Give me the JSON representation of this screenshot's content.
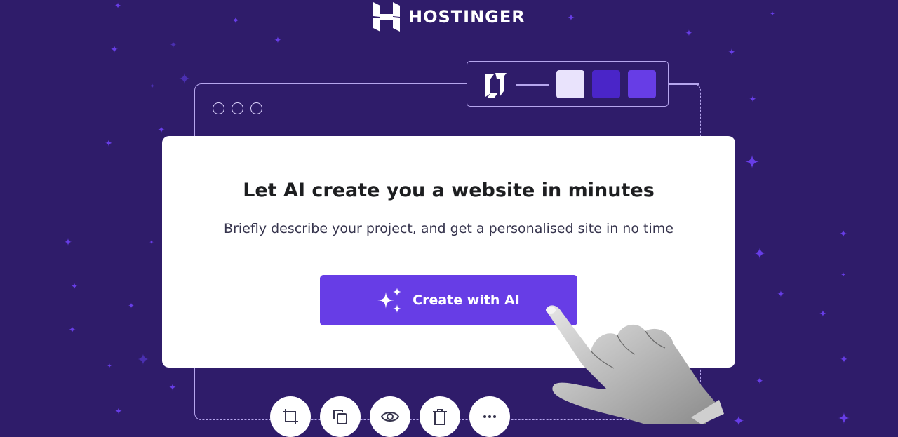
{
  "brand": {
    "name": "HOSTINGER"
  },
  "hero": {
    "title": "Let AI create you a website in minutes",
    "subtitle": "Briefly describe your project, and get a personalised site in no time",
    "cta_label": "Create with AI",
    "cta_icon": "sparkles-icon"
  },
  "palette": {
    "icon": "hostinger-cube-icon",
    "swatches": [
      "#e9e3fc",
      "#4a25c8",
      "#673de6"
    ]
  },
  "toolbar": {
    "items": [
      {
        "name": "crop",
        "icon": "crop-icon"
      },
      {
        "name": "duplicate",
        "icon": "copy-icon"
      },
      {
        "name": "preview",
        "icon": "eye-icon"
      },
      {
        "name": "delete",
        "icon": "trash-icon"
      },
      {
        "name": "more",
        "icon": "more-icon"
      }
    ]
  },
  "colors": {
    "background": "#2f1c6a",
    "accent": "#673de6",
    "card": "#ffffff",
    "title": "#1d1e20"
  }
}
